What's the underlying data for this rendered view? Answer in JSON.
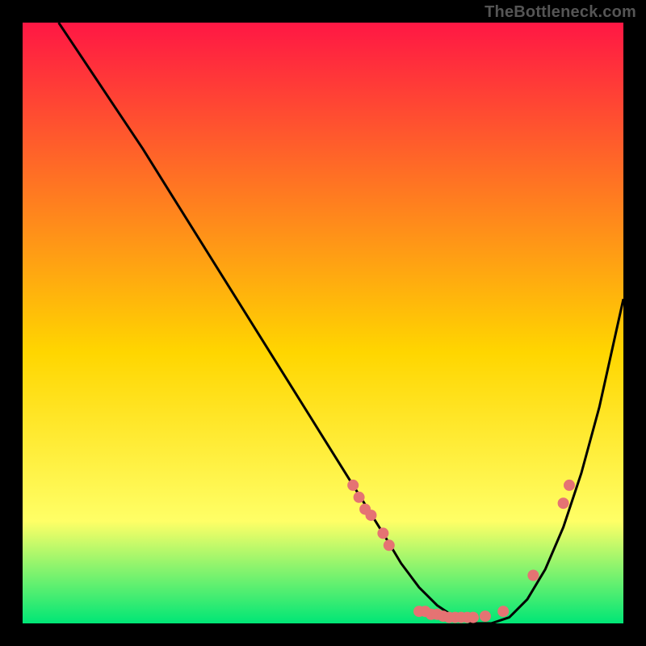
{
  "watermark": "TheBottleneck.com",
  "chart_data": {
    "type": "line",
    "title": "",
    "xlabel": "",
    "ylabel": "",
    "xlim": [
      0,
      100
    ],
    "ylim": [
      0,
      100
    ],
    "plot_bg_gradient": [
      "#ff1744",
      "#ffd600",
      "#ffff66",
      "#00e676"
    ],
    "series": [
      {
        "name": "curve",
        "color": "#000000",
        "x": [
          6,
          8,
          12,
          16,
          20,
          25,
          30,
          35,
          40,
          45,
          50,
          55,
          60,
          63,
          66,
          69,
          72,
          75,
          78,
          81,
          84,
          87,
          90,
          93,
          96,
          100
        ],
        "y": [
          100,
          97,
          91,
          85,
          79,
          71,
          63,
          55,
          47,
          39,
          31,
          23,
          15,
          10,
          6,
          3,
          1,
          0,
          0,
          1,
          4,
          9,
          16,
          25,
          36,
          54
        ]
      }
    ],
    "markers": {
      "name": "highlighted-points",
      "color": "#e57373",
      "radius": 7,
      "points": [
        {
          "x": 55,
          "y": 23
        },
        {
          "x": 56,
          "y": 21
        },
        {
          "x": 57,
          "y": 19
        },
        {
          "x": 58,
          "y": 18
        },
        {
          "x": 60,
          "y": 15
        },
        {
          "x": 61,
          "y": 13
        },
        {
          "x": 66,
          "y": 2
        },
        {
          "x": 67,
          "y": 2
        },
        {
          "x": 68,
          "y": 1.5
        },
        {
          "x": 69,
          "y": 1.5
        },
        {
          "x": 70,
          "y": 1.2
        },
        {
          "x": 71,
          "y": 1.0
        },
        {
          "x": 72,
          "y": 1.0
        },
        {
          "x": 73,
          "y": 1.0
        },
        {
          "x": 74,
          "y": 1.0
        },
        {
          "x": 75,
          "y": 1.0
        },
        {
          "x": 77,
          "y": 1.2
        },
        {
          "x": 80,
          "y": 2
        },
        {
          "x": 85,
          "y": 8
        },
        {
          "x": 90,
          "y": 20
        },
        {
          "x": 91,
          "y": 23
        }
      ]
    }
  }
}
